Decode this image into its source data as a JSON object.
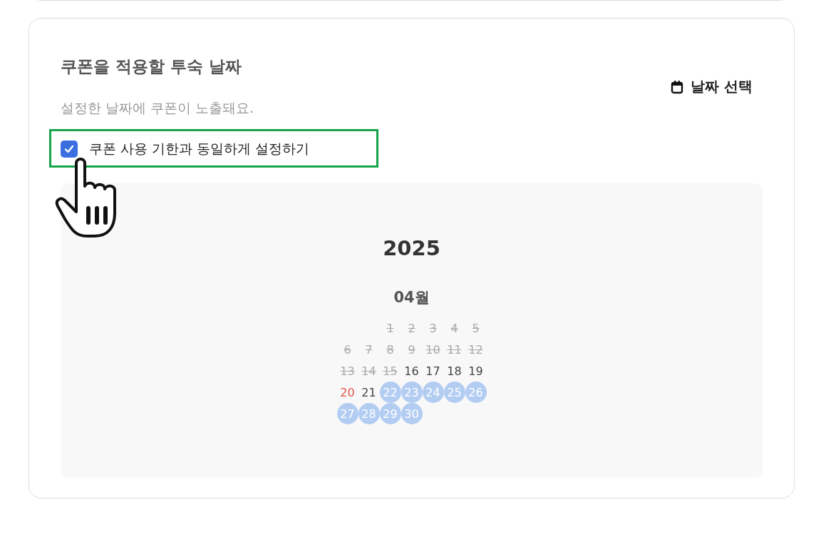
{
  "section": {
    "title": "쿠폰을 적용할 투숙 날짜",
    "description": "설정한 날짜에 쿠폰이 노출돼요.",
    "date_button": "날짜 선택"
  },
  "same_as_expiry": {
    "label": "쿠폰 사용 기한과 동일하게 설정하기",
    "checked": true
  },
  "calendar": {
    "year": "2025",
    "month": "04월",
    "weeks": [
      [
        {
          "day": "1",
          "kind": "past",
          "selected": false
        },
        {
          "day": "2",
          "kind": "past",
          "selected": false
        },
        {
          "day": "3",
          "kind": "past",
          "selected": false
        },
        {
          "day": "4",
          "kind": "past",
          "selected": false
        },
        {
          "day": "5",
          "kind": "past",
          "selected": false
        }
      ],
      [
        {
          "day": "6",
          "kind": "past",
          "selected": false
        },
        {
          "day": "7",
          "kind": "past",
          "selected": false
        },
        {
          "day": "8",
          "kind": "past",
          "selected": false
        },
        {
          "day": "9",
          "kind": "past",
          "selected": false
        },
        {
          "day": "10",
          "kind": "past",
          "selected": false
        },
        {
          "day": "11",
          "kind": "past",
          "selected": false
        },
        {
          "day": "12",
          "kind": "past",
          "selected": false
        }
      ],
      [
        {
          "day": "13",
          "kind": "past",
          "selected": false
        },
        {
          "day": "14",
          "kind": "past",
          "selected": false
        },
        {
          "day": "15",
          "kind": "past",
          "selected": false
        },
        {
          "day": "16",
          "kind": "normal",
          "selected": false
        },
        {
          "day": "17",
          "kind": "normal",
          "selected": false
        },
        {
          "day": "18",
          "kind": "normal",
          "selected": false
        },
        {
          "day": "19",
          "kind": "normal",
          "selected": false
        }
      ],
      [
        {
          "day": "20",
          "kind": "sunday",
          "selected": false
        },
        {
          "day": "21",
          "kind": "normal",
          "selected": false
        },
        {
          "day": "22",
          "kind": "normal",
          "selected": true
        },
        {
          "day": "23",
          "kind": "normal",
          "selected": true
        },
        {
          "day": "24",
          "kind": "normal",
          "selected": true
        },
        {
          "day": "25",
          "kind": "normal",
          "selected": true
        },
        {
          "day": "26",
          "kind": "normal",
          "selected": true
        }
      ],
      [
        {
          "day": "27",
          "kind": "normal",
          "selected": true
        },
        {
          "day": "28",
          "kind": "normal",
          "selected": true
        },
        {
          "day": "29",
          "kind": "normal",
          "selected": true
        },
        {
          "day": "30",
          "kind": "normal",
          "selected": true
        }
      ]
    ]
  }
}
